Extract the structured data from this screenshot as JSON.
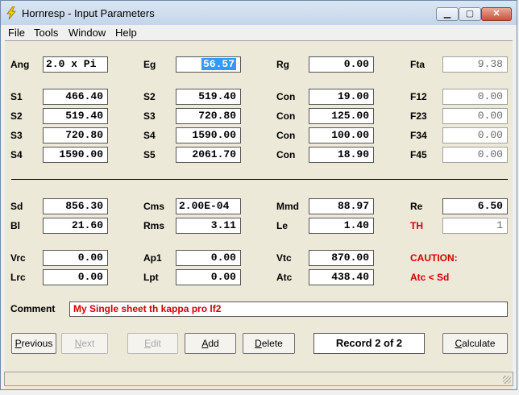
{
  "window": {
    "title": "Hornresp - Input Parameters",
    "min_glyph": "▁",
    "max_glyph": "▢",
    "close_glyph": "✕"
  },
  "menu": [
    "File",
    "Tools",
    "Window",
    "Help"
  ],
  "row1": {
    "ang": {
      "label": "Ang",
      "value": "2.0 x Pi"
    },
    "eg": {
      "label": "Eg",
      "value": "56.57"
    },
    "rg": {
      "label": "Rg",
      "value": "0.00"
    },
    "fta": {
      "label": "Fta",
      "value": "9.38"
    }
  },
  "segments": [
    {
      "s1": {
        "label": "S1",
        "value": "466.40"
      },
      "s2": {
        "label": "S2",
        "value": "519.40"
      },
      "con": {
        "label": "Con",
        "value": "19.00"
      },
      "f": {
        "label": "F12",
        "value": "0.00"
      }
    },
    {
      "s1": {
        "label": "S2",
        "value": "519.40"
      },
      "s2": {
        "label": "S3",
        "value": "720.80"
      },
      "con": {
        "label": "Con",
        "value": "125.00"
      },
      "f": {
        "label": "F23",
        "value": "0.00"
      }
    },
    {
      "s1": {
        "label": "S3",
        "value": "720.80"
      },
      "s2": {
        "label": "S4",
        "value": "1590.00"
      },
      "con": {
        "label": "Con",
        "value": "100.00"
      },
      "f": {
        "label": "F34",
        "value": "0.00"
      }
    },
    {
      "s1": {
        "label": "S4",
        "value": "1590.00"
      },
      "s2": {
        "label": "S5",
        "value": "2061.70"
      },
      "con": {
        "label": "Con",
        "value": "18.90"
      },
      "f": {
        "label": "F45",
        "value": "0.00"
      }
    }
  ],
  "driver": {
    "sd": {
      "label": "Sd",
      "value": "856.30"
    },
    "cms": {
      "label": "Cms",
      "value": "2.00E-04"
    },
    "mmd": {
      "label": "Mmd",
      "value": "88.97"
    },
    "re": {
      "label": "Re",
      "value": "6.50"
    },
    "bl": {
      "label": "Bl",
      "value": "21.60"
    },
    "rms": {
      "label": "Rms",
      "value": "3.11"
    },
    "le": {
      "label": "Le",
      "value": "1.40"
    },
    "th": {
      "label": "TH",
      "value": "1"
    }
  },
  "chambers": {
    "vrc": {
      "label": "Vrc",
      "value": "0.00"
    },
    "ap1": {
      "label": "Ap1",
      "value": "0.00"
    },
    "vtc": {
      "label": "Vtc",
      "value": "870.00"
    },
    "lrc": {
      "label": "Lrc",
      "value": "0.00"
    },
    "lpt": {
      "label": "Lpt",
      "value": "0.00"
    },
    "atc": {
      "label": "Atc",
      "value": "438.40"
    }
  },
  "caution": {
    "title": "CAUTION:",
    "message": "Atc < Sd"
  },
  "comment": {
    "label": "Comment",
    "value": "My Single sheet th kappa pro lf2"
  },
  "buttons": {
    "previous": {
      "first": "P",
      "rest": "revious"
    },
    "next": {
      "first": "N",
      "rest": "ext"
    },
    "edit": {
      "first": "E",
      "rest": "dit"
    },
    "add": {
      "first": "A",
      "rest": "dd"
    },
    "delete": {
      "first": "D",
      "rest": "elete"
    },
    "calculate": {
      "first": "C",
      "rest": "alculate"
    }
  },
  "record": "Record 2 of 2",
  "colors": {
    "selection": "#3399ff",
    "caution": "#d40000",
    "comment_text": "#d40000"
  }
}
